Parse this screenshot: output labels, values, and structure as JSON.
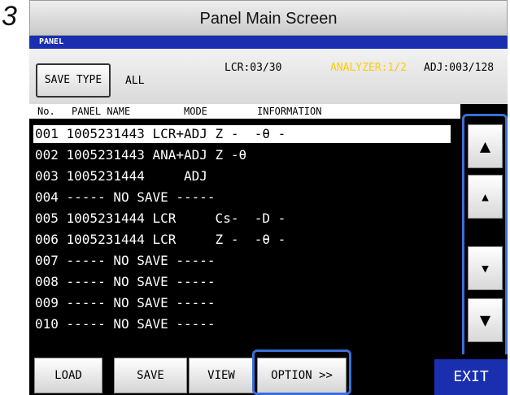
{
  "step_number": "3",
  "caption": "Panel Main Screen",
  "titlebar": "PANEL",
  "save_type": {
    "button_label": "SAVE TYPE",
    "value": "ALL"
  },
  "status": {
    "lcr": "LCR:03/30",
    "analyzer": "ANALYZER:1/2",
    "adj": "ADJ:003/128"
  },
  "header": {
    "no": "No.",
    "panel_name": "PANEL NAME",
    "mode": "MODE",
    "information": "INFORMATION"
  },
  "rows": [
    "001 1005231443 LCR+ADJ Z -  -θ -",
    "002 1005231443 ANA+ADJ Z -θ",
    "003 1005231444     ADJ",
    "004 ----- NO SAVE -----",
    "005 1005231444 LCR     Cs-  -D -",
    "006 1005231444 LCR     Z -  -θ -",
    "007 ----- NO SAVE -----",
    "008 ----- NO SAVE -----",
    "009 ----- NO SAVE -----",
    "010 ----- NO SAVE -----"
  ],
  "selected_row": 0,
  "scroll_icons": {
    "page_up": "▲",
    "line_up": "▴",
    "line_down": "▾",
    "page_down": "▼"
  },
  "buttons": {
    "load": "LOAD",
    "save": "SAVE",
    "view": "VIEW",
    "option": "OPTION >>",
    "exit": "EXIT"
  },
  "colors": {
    "titlebar": "#1a2fb0",
    "analyzer_status": "#ffcc00",
    "highlight_frame": "#3b6fd6"
  }
}
